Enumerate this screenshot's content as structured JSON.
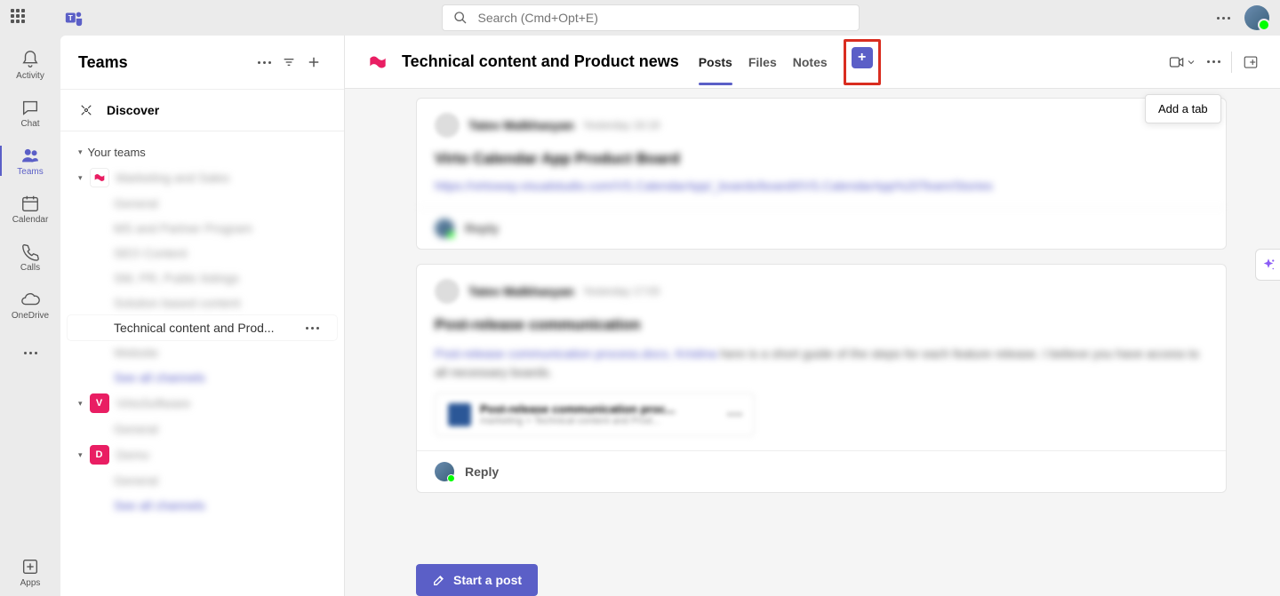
{
  "search": {
    "placeholder": "Search (Cmd+Opt+E)"
  },
  "rail": {
    "items": [
      {
        "label": "Activity"
      },
      {
        "label": "Chat"
      },
      {
        "label": "Teams"
      },
      {
        "label": "Calendar"
      },
      {
        "label": "Calls"
      },
      {
        "label": "OneDrive"
      }
    ],
    "apps_label": "Apps"
  },
  "sidebar": {
    "title": "Teams",
    "discover": "Discover",
    "your_teams": "Your teams",
    "teams": [
      {
        "name": "Marketing and Sales",
        "channels": [
          "General",
          "MS and Partner Program",
          "SEO Content",
          "SM, PR, Public listings",
          "Solution based content",
          "Technical content and Prod...",
          "Website",
          "See all channels"
        ]
      },
      {
        "name": "VirtoSoftware",
        "initial": "V",
        "channels": [
          "General"
        ]
      },
      {
        "name": "Demo",
        "initial": "D",
        "channels": [
          "General",
          "See all channels"
        ]
      }
    ],
    "active_channel": "Technical content and Prod..."
  },
  "channel": {
    "title": "Technical content and Product news",
    "tabs": [
      "Posts",
      "Files",
      "Notes"
    ],
    "add_tab_tooltip": "Add a tab"
  },
  "posts": [
    {
      "author": "Tatev Malkhasyan",
      "time": "Yesterday 16:19",
      "title": "Virto Calendar App Product Board",
      "link": "https://virtoway.visualstudio.com/VS.CalendarApp/_boards/board/t/VS.CalendarApp%20Team/Stories",
      "reply": "Reply"
    },
    {
      "author": "Tatev Malkhasyan",
      "time": "Yesterday 17:03",
      "title": "Post-release communication",
      "link_text": "Post-release communication process.docx, Kristina",
      "body": " here is a short guide of the steps for each feature release. I believe you have access to all necessary boards.",
      "attachment": {
        "title": "Post-release communication proc...",
        "subtitle": "marketing > Technical content and Prod..."
      },
      "reply": "Reply"
    }
  ],
  "start_post": "Start a post"
}
